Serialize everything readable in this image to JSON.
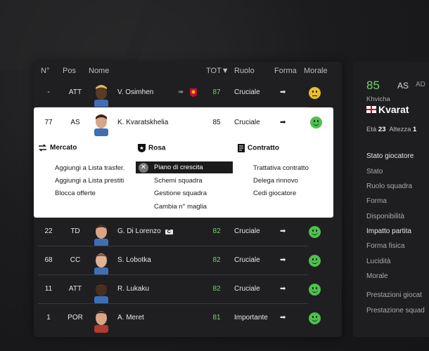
{
  "table": {
    "headers": {
      "n": "N°",
      "pos": "Pos",
      "nome": "Nome",
      "tot": "TOT▼",
      "ruolo": "Ruolo",
      "forma": "Forma",
      "morale": "Morale"
    },
    "rows": [
      {
        "n": "-",
        "pos": "ATT",
        "name": "V. Osimhen",
        "tot": "87",
        "ruolo": "Cruciale",
        "forma": "➡",
        "morale": "neutral"
      },
      {
        "n": "22",
        "pos": "TD",
        "name": "G. Di Lorenzo",
        "badge": "C",
        "tot": "82",
        "ruolo": "Cruciale",
        "forma": "➡",
        "morale": "happy"
      },
      {
        "n": "68",
        "pos": "CC",
        "name": "S. Lobotka",
        "tot": "82",
        "ruolo": "Cruciale",
        "forma": "➡",
        "morale": "happy"
      },
      {
        "n": "11",
        "pos": "ATT",
        "name": "R. Lukaku",
        "tot": "82",
        "ruolo": "Cruciale",
        "forma": "➡",
        "morale": "happy"
      },
      {
        "n": "1",
        "pos": "POR",
        "name": "A. Meret",
        "tot": "81",
        "ruolo": "Importante",
        "forma": "➡",
        "morale": "happy"
      }
    ],
    "selected": {
      "n": "77",
      "pos": "AS",
      "name": "K. Kvaratskhelia",
      "tot": "85",
      "ruolo": "Cruciale",
      "forma": "➡",
      "morale": "happy"
    }
  },
  "menu": {
    "mercato": {
      "title": "Mercato",
      "items": [
        "Aggiungi a Lista trasfer.",
        "Aggiungi a Lista prestiti",
        "Blocca offerte"
      ]
    },
    "rosa": {
      "title": "Rosa",
      "items": [
        "Piano di crescita",
        "Schemi squadra",
        "Gestione squadra",
        "Cambia n° maglia"
      ]
    },
    "contratto": {
      "title": "Contratto",
      "items": [
        "Trattativa contratto",
        "Delega rinnovo",
        "Cedi giocatore"
      ]
    }
  },
  "detail": {
    "ovr": "85",
    "pos": "AS",
    "pos_extra": "AD",
    "firstname": "Khvicha",
    "surname": "Kvarat",
    "eta_label": "Età",
    "eta": "23",
    "altezza_label": "Altezza",
    "altezza": "1",
    "labels": [
      "Stato giocatore",
      "Stato",
      "Ruolo squadra",
      "Forma",
      "Disponibilità",
      "Impatto partita",
      "Forma fisica",
      "Lucidità",
      "Morale",
      "Prestazioni giocat",
      "Prestazione squad"
    ]
  },
  "colors": {
    "accent_green": "#6fd36f",
    "selected_bg": "#ffffff",
    "panel_bg": "#1f1f21"
  }
}
